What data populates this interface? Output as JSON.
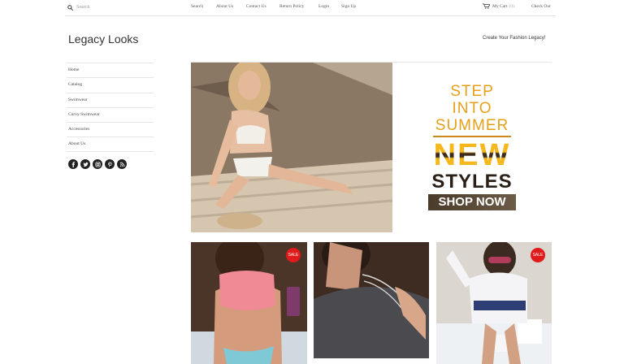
{
  "search": {
    "placeholder": "Search"
  },
  "topnav": [
    "Search",
    "About Us",
    "Contact Us",
    "Return Policy",
    "Login",
    "Sign Up"
  ],
  "cart": {
    "label": "My Cart",
    "count": "(0)"
  },
  "checkout": "Check Out",
  "logo": "Legacy Looks",
  "tagline": "Create Your Fashion Legacy!",
  "sidebar": [
    "Home",
    "Catalog",
    "Swimwear",
    "Curvy Swimwear",
    "Accessories",
    "About Us"
  ],
  "social": [
    "facebook-icon",
    "twitter-icon",
    "instagram-icon",
    "pinterest-icon",
    "rss-icon"
  ],
  "promo": {
    "line1": "STEP INTO",
    "line2": "SUMMER",
    "line3": "NEW",
    "line4": "STYLES",
    "cta": "SHOP NOW"
  },
  "products": [
    {
      "badge": "SALE"
    },
    {
      "badge": ""
    },
    {
      "badge": "SALE"
    }
  ]
}
